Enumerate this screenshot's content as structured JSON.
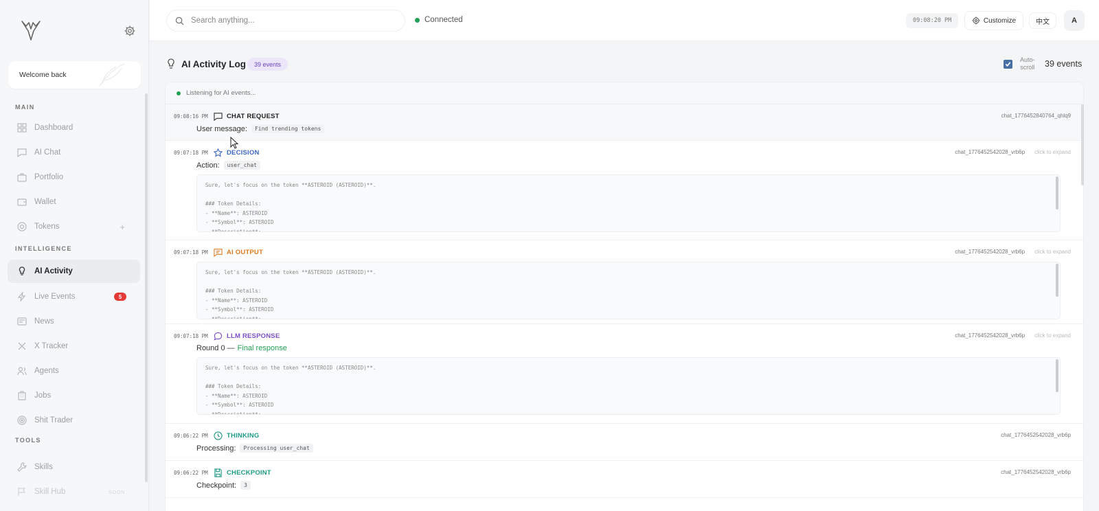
{
  "sidebar": {
    "welcome": "Welcome back",
    "sections": {
      "main": "MAIN",
      "intelligence": "INTELLIGENCE",
      "tools": "TOOLS"
    },
    "items": [
      {
        "label": "Dashboard"
      },
      {
        "label": "AI Chat"
      },
      {
        "label": "Portfolio"
      },
      {
        "label": "Wallet"
      },
      {
        "label": "Tokens",
        "extra": "+"
      },
      {
        "label": "AI Activity"
      },
      {
        "label": "Live Events",
        "badge": "5"
      },
      {
        "label": "News"
      },
      {
        "label": "X Tracker"
      },
      {
        "label": "Agents"
      },
      {
        "label": "Jobs"
      },
      {
        "label": "Shit Trader"
      },
      {
        "label": "Skills"
      },
      {
        "label": "Skill Hub",
        "tag": "SOON"
      }
    ]
  },
  "topbar": {
    "search_placeholder": "Search anything...",
    "status": "Connected",
    "time": "09:08:20 PM",
    "customize": "Customize",
    "language": "中文",
    "avatar": "A"
  },
  "log": {
    "title": "AI Activity Log",
    "count_badge": "39 events",
    "autoscroll": [
      "Auto-",
      "scroll"
    ],
    "event_total": "39 events",
    "listening": "Listening for AI events...",
    "expand_hint": "click to expand",
    "events": [
      {
        "time": "09:08:16 PM",
        "type": "CHAT REQUEST",
        "id": "chat_1776452840764_qhlq9",
        "label": "User message:",
        "chip": "Find trending tokens"
      },
      {
        "time": "09:07:18 PM",
        "type": "DECISION",
        "id": "chat_1776452542028_vrb6p",
        "label": "Action:",
        "chip": "user_chat",
        "code": "Sure, let's focus on the token **ASTEROID (ASTEROID)**.\n\n### Token Details:\n- **Name**: ASTEROID\n- **Symbol**: ASTEROID\n- **Description**:"
      },
      {
        "time": "09:07:18 PM",
        "type": "AI OUTPUT",
        "id": "chat_1776452542028_vrb6p",
        "code": "Sure, let's focus on the token **ASTEROID (ASTEROID)**.\n\n### Token Details:\n- **Name**: ASTEROID\n- **Symbol**: ASTEROID\n- **Description**:"
      },
      {
        "time": "09:07:18 PM",
        "type": "LLM RESPONSE",
        "id": "chat_1776452542028_vrb6p",
        "label": "Round 0 —",
        "highlight": "Final response",
        "code": "Sure, let's focus on the token **ASTEROID (ASTEROID)**.\n\n### Token Details:\n- **Name**: ASTEROID\n- **Symbol**: ASTEROID\n- **Description**:"
      },
      {
        "time": "09:06:22 PM",
        "type": "THINKING",
        "id": "chat_1776452542028_vrb6p",
        "label": "Processing:",
        "chip": "Processing user_chat"
      },
      {
        "time": "09:06:22 PM",
        "type": "CHECKPOINT",
        "id": "chat_1776452542028_vrb6p",
        "label": "Checkpoint:",
        "chip": "3"
      }
    ]
  },
  "colors": {
    "decision": "#3f68c4",
    "ai_output": "#e07b22",
    "llm_response": "#7b4fc9",
    "thinking": "#1f9a86",
    "checkpoint": "#1f9a86",
    "chat_request": "#222222",
    "connected": "#22a055"
  }
}
